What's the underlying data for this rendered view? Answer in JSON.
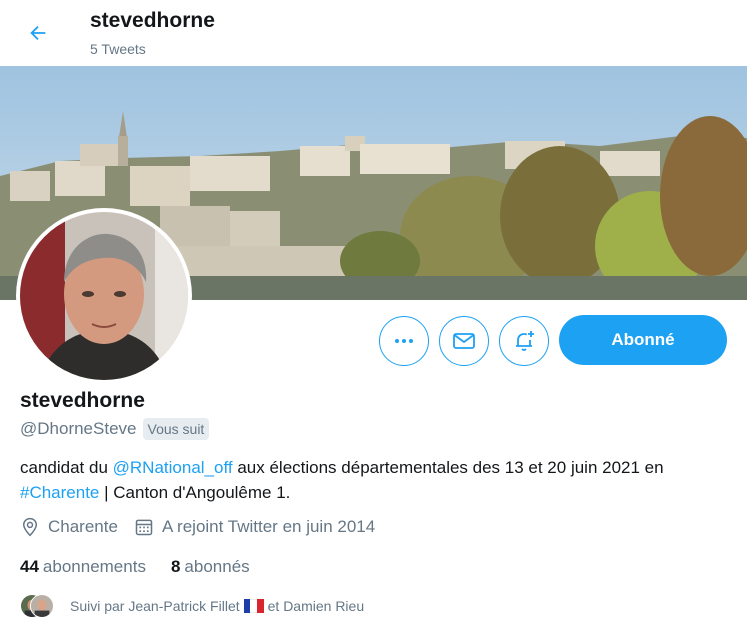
{
  "header": {
    "display_name": "stevedhorne",
    "tweet_count": "5 Tweets"
  },
  "actions": {
    "follow_label": "Abonné"
  },
  "profile": {
    "display_name": "stevedhorne",
    "handle": "@DhorneSteve",
    "follows_you_badge": "Vous suit",
    "bio": {
      "text1": "candidat du ",
      "mention": "@RNational_off",
      "text2": " aux élections départementales des 13 et 20 juin 2021 en ",
      "hashtag": "#Charente",
      "text3": " | Canton d'Angoulême 1."
    },
    "location": "Charente",
    "joined": "A rejoint Twitter en juin 2014",
    "following_count": "44",
    "following_label": "abonnements",
    "followers_count": "8",
    "followers_label": "abonnés",
    "followed_by": {
      "prefix": "Suivi par Jean-Patrick Fillet",
      "suffix": "et Damien Rieu"
    }
  },
  "icons": {
    "back": "arrow-left-icon",
    "more": "more-icon",
    "message": "envelope-icon",
    "notifications": "bell-plus-icon",
    "location": "location-pin-icon",
    "calendar": "calendar-icon"
  },
  "colors": {
    "accent": "#1da1f2",
    "text_primary": "#14171a",
    "text_secondary": "#657786"
  }
}
